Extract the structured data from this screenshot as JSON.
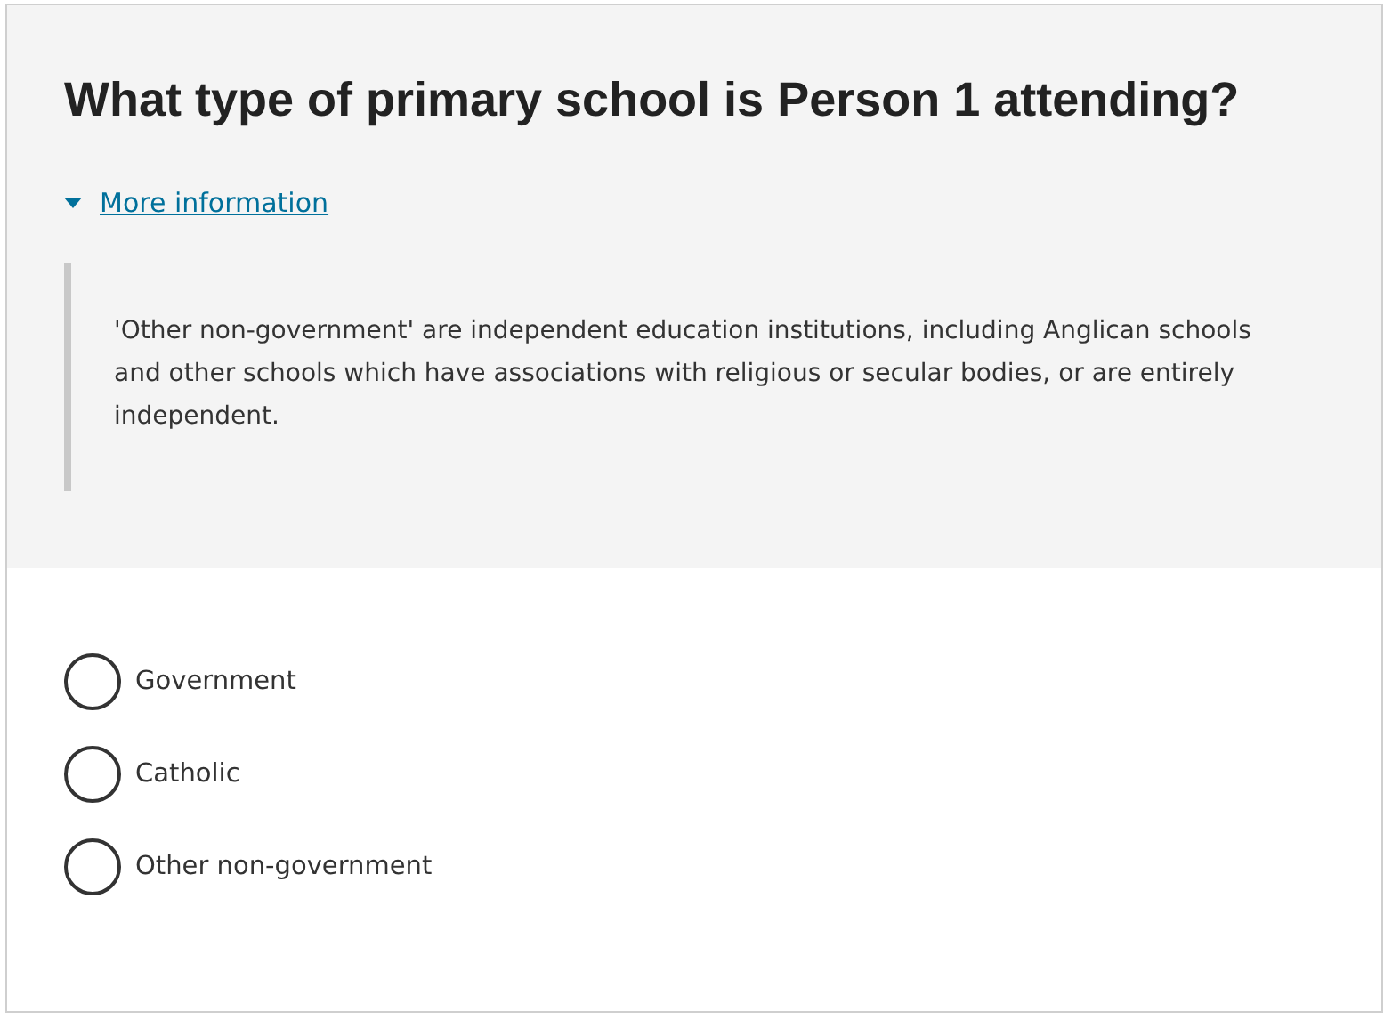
{
  "question": {
    "title": "What type of primary school is Person 1 attending?"
  },
  "more_information": {
    "label": "More information",
    "expanded": true,
    "text": "'Other non-government' are independent education institutions, including Anglican schools and other schools which have associations with religious or secular bodies, or are entirely independent."
  },
  "options": [
    {
      "label": "Government",
      "selected": false
    },
    {
      "label": "Catholic",
      "selected": false
    },
    {
      "label": "Other non-government",
      "selected": false
    }
  ]
}
